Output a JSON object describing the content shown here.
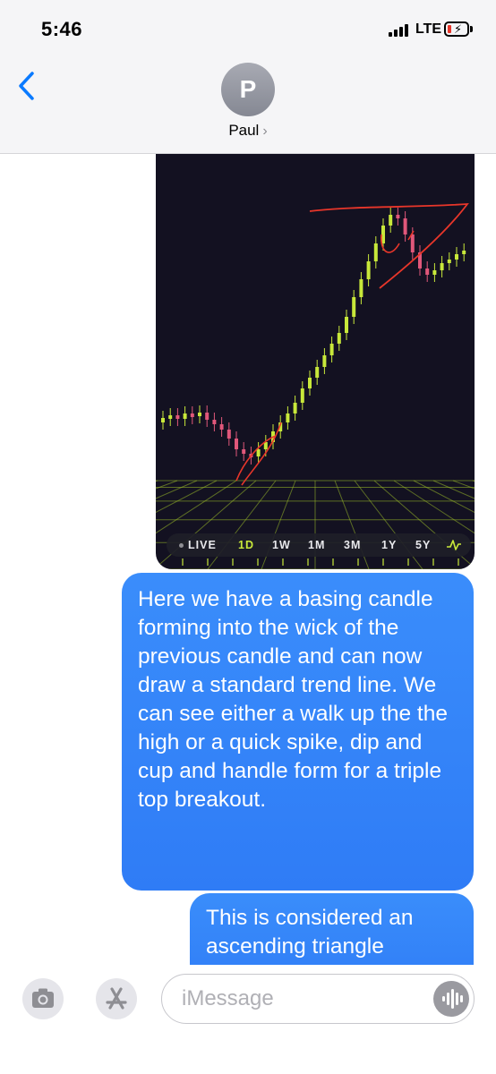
{
  "status_bar": {
    "time": "5:46",
    "network": "LTE"
  },
  "header": {
    "avatar_initial": "P",
    "contact_name": "Paul",
    "chevron": "›"
  },
  "chart_image": {
    "ranges": [
      {
        "label": "LIVE",
        "active": false
      },
      {
        "label": "1D",
        "active": true
      },
      {
        "label": "1W",
        "active": false
      },
      {
        "label": "1M",
        "active": false
      },
      {
        "label": "3M",
        "active": false
      },
      {
        "label": "1Y",
        "active": false
      },
      {
        "label": "5Y",
        "active": false
      }
    ],
    "colors": {
      "background": "#131121",
      "up": "#c8e83a",
      "down": "#e0577a",
      "annotation": "#e8362a",
      "grid": "#9bbb2a"
    }
  },
  "messages": [
    {
      "text": "Here we have a basing candle forming into the wick of the previous candle and can now draw a standard trend line. We can see either a walk up the the high or a quick spike, dip and cup and handle form for a triple top breakout."
    },
    {
      "text": "This is considered an ascending triangle"
    }
  ],
  "composer": {
    "placeholder": "iMessage"
  },
  "icons": {
    "back": "chevron-left-icon",
    "camera": "camera-icon",
    "apps": "app-store-icon",
    "audio": "audio-waveform-icon",
    "chart_type": "line-chart-icon"
  }
}
